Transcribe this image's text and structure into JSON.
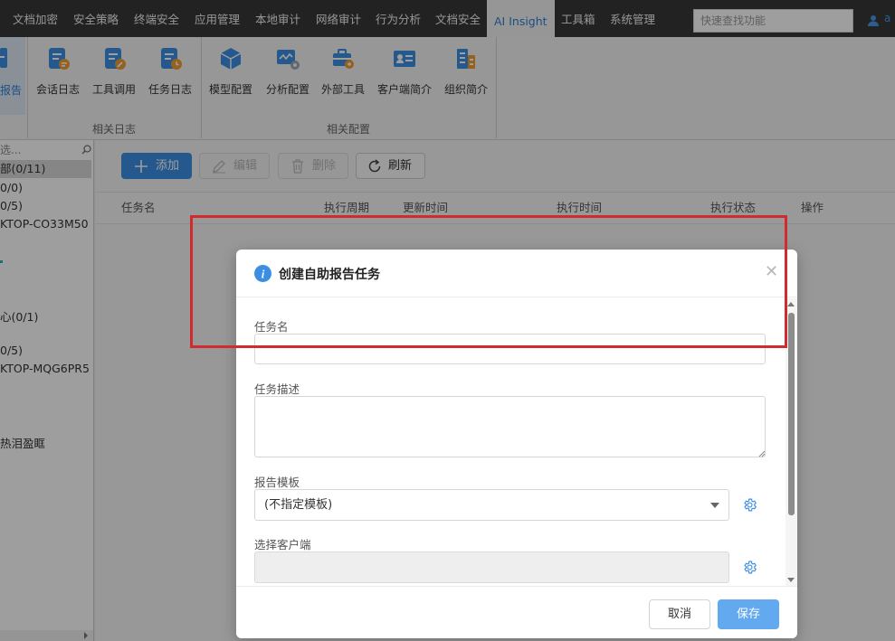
{
  "nav": {
    "items": [
      "文档加密",
      "安全策略",
      "终端安全",
      "应用管理",
      "本地审计",
      "网络审计",
      "行为分析",
      "文档安全",
      "AI Insight",
      "工具箱",
      "系统管理"
    ],
    "active": "AI Insight",
    "search_placeholder": "快速查找功能",
    "user_label": "a"
  },
  "ribbon": {
    "first_label": "报告",
    "log_buttons": [
      "会话日志",
      "工具调用",
      "任务日志"
    ],
    "config_buttons": [
      "模型配置",
      "分析配置",
      "外部工具",
      "客户端简介",
      "组织简介"
    ],
    "group_logs": "相关日志",
    "group_config": "相关配置"
  },
  "tree": {
    "search_text": "选...",
    "nodes": [
      "部(0/11)",
      "0/0)",
      "0/5)",
      "KTOP-CO33M50",
      "心(0/1)",
      "0/5)",
      "KTOP-MQG6PR5",
      "热泪盈眶"
    ]
  },
  "toolbar": {
    "add": "添加",
    "edit": "编辑",
    "delete": "删除",
    "refresh": "刷新"
  },
  "grid": {
    "columns": [
      "任务名",
      "执行周期",
      "更新时间",
      "执行时间",
      "执行状态",
      "操作"
    ]
  },
  "dialog": {
    "title": "创建自助报告任务",
    "task_name_label": "任务名",
    "task_name_value": "",
    "task_desc_label": "任务描述",
    "task_desc_value": "",
    "template_label": "报告模板",
    "template_value": "(不指定模板)",
    "client_label": "选择客户端",
    "client_value": "",
    "cancel": "取消",
    "save": "保存"
  },
  "colors": {
    "accent": "#3c8ee3",
    "save_button": "#62a9f0",
    "highlight_box": "#d12a2f",
    "nav_bar": "#383838"
  }
}
